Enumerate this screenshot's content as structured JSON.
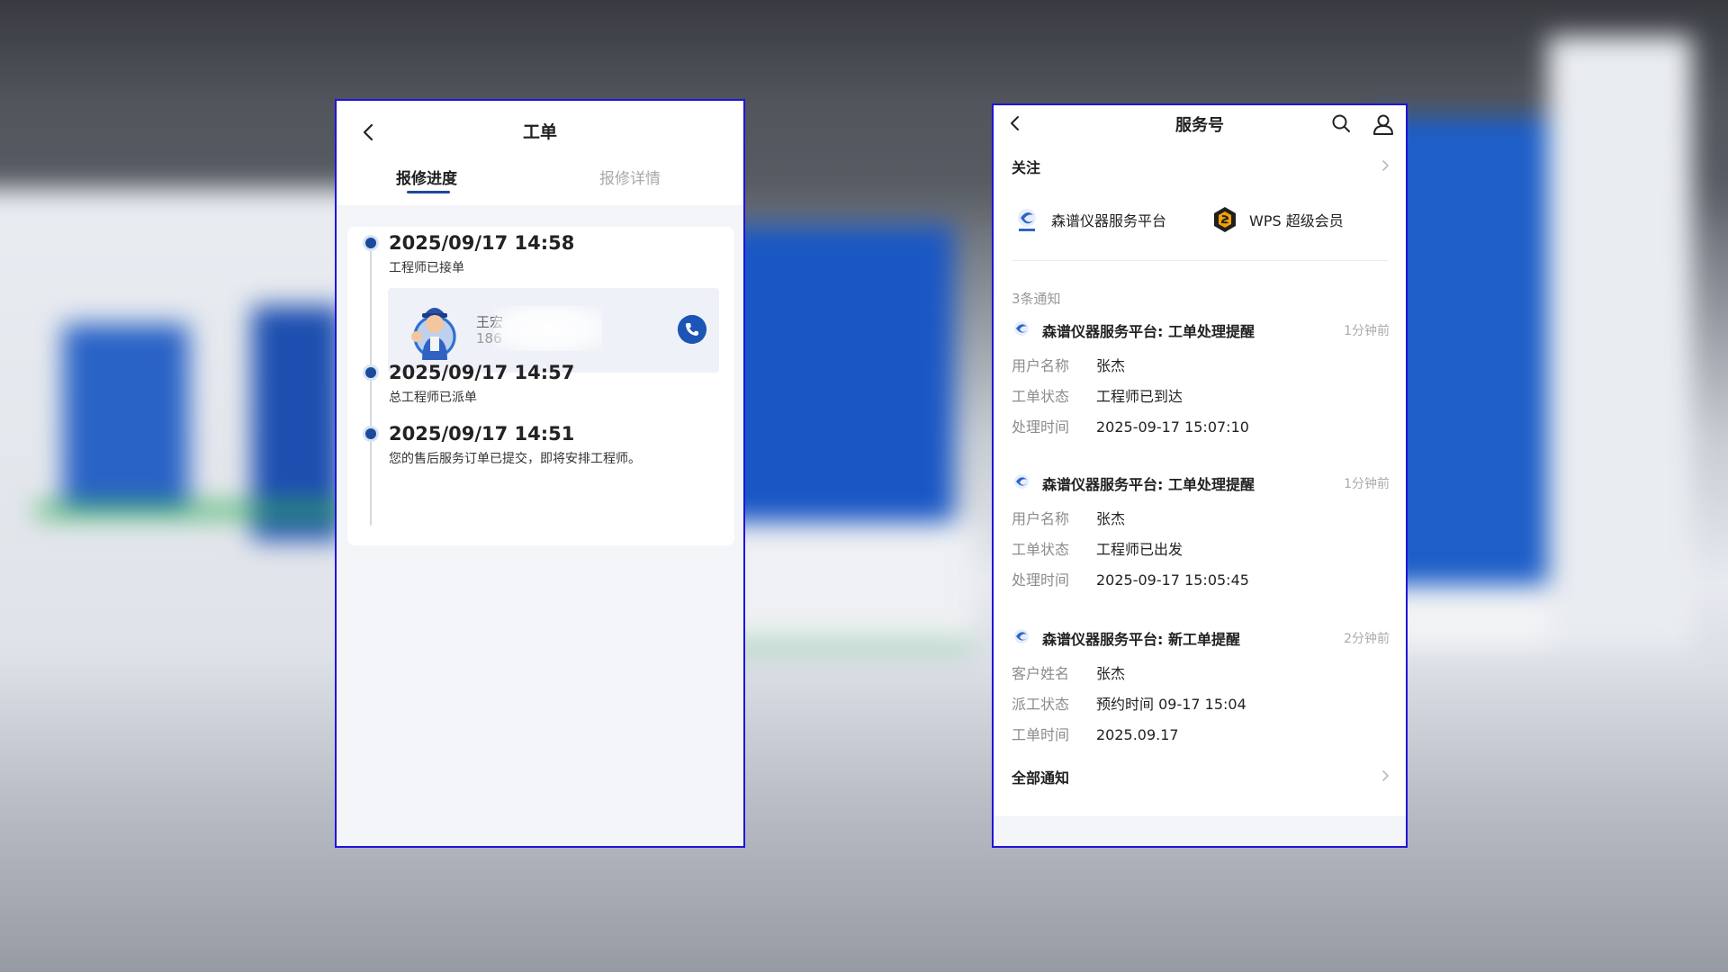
{
  "left": {
    "header": {
      "title": "工单"
    },
    "tabs": [
      {
        "label": "报修进度",
        "active": true
      },
      {
        "label": "报修详情",
        "active": false
      }
    ],
    "timeline": [
      {
        "time": "2025/09/17 14:58",
        "desc": "工程师已接单"
      },
      {
        "time": "2025/09/17 14:57",
        "desc": "总工程师已派单"
      },
      {
        "time": "2025/09/17 14:51",
        "desc": "您的售后服务订单已提交，即将安排工程师。"
      }
    ],
    "engineer": {
      "name": "王宏",
      "phone": "186"
    }
  },
  "right": {
    "header": {
      "title": "服务号"
    },
    "follow": {
      "label": "关注",
      "accounts": [
        {
          "label": "森谱仪器服务平台"
        },
        {
          "label": "WPS 超级会员"
        }
      ]
    },
    "count_label": "3条通知",
    "notices": [
      {
        "title": "森谱仪器服务平台: 工单处理提醒",
        "time": "1分钟前",
        "rows": [
          {
            "key": "用户名称",
            "value": "张杰"
          },
          {
            "key": "工单状态",
            "value": "工程师已到达"
          },
          {
            "key": "处理时间",
            "value": "2025-09-17 15:07:10"
          }
        ]
      },
      {
        "title": "森谱仪器服务平台: 工单处理提醒",
        "time": "1分钟前",
        "rows": [
          {
            "key": "用户名称",
            "value": "张杰"
          },
          {
            "key": "工单状态",
            "value": "工程师已出发"
          },
          {
            "key": "处理时间",
            "value": "2025-09-17 15:05:45"
          }
        ]
      },
      {
        "title": "森谱仪器服务平台: 新工单提醒",
        "time": "2分钟前",
        "rows": [
          {
            "key": "客户姓名",
            "value": "张杰"
          },
          {
            "key": "派工状态",
            "value": "预约时间 09-17 15:04"
          },
          {
            "key": "工单时间",
            "value": "2025.09.17"
          }
        ]
      }
    ],
    "all_label": "全部通知"
  },
  "colors": {
    "border": "#1f14d8",
    "accent": "#1c4a9a",
    "call": "#1c55b5",
    "wps": "#f2a100"
  }
}
